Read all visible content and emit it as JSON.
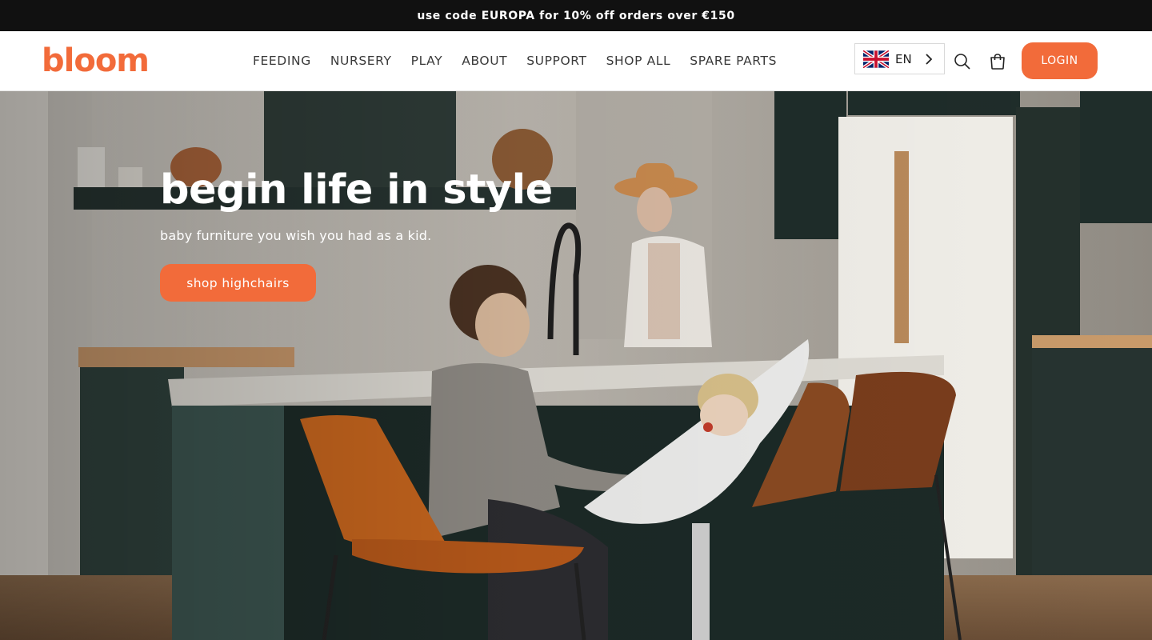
{
  "announcement": {
    "text": "use code EUROPA for 10% off orders over €150"
  },
  "header": {
    "logo": "bloom",
    "nav": [
      {
        "label": "FEEDING"
      },
      {
        "label": "NURSERY"
      },
      {
        "label": "PLAY"
      },
      {
        "label": "ABOUT"
      },
      {
        "label": "SUPPORT"
      },
      {
        "label": "SHOP ALL"
      },
      {
        "label": "SPARE PARTS"
      }
    ],
    "language": {
      "code": "EN",
      "flag": "uk-flag-icon"
    },
    "icons": {
      "search": "search-icon",
      "cart": "cart-icon",
      "chevron": "chevron-right-icon"
    },
    "login_label": "LOGIN"
  },
  "hero": {
    "title": "begin life in style",
    "subtitle": "baby furniture you wish you had as a kid.",
    "cta_label": "shop highchairs"
  },
  "colors": {
    "accent": "#f26b3a",
    "announcement_bg": "#111111",
    "white": "#ffffff"
  }
}
